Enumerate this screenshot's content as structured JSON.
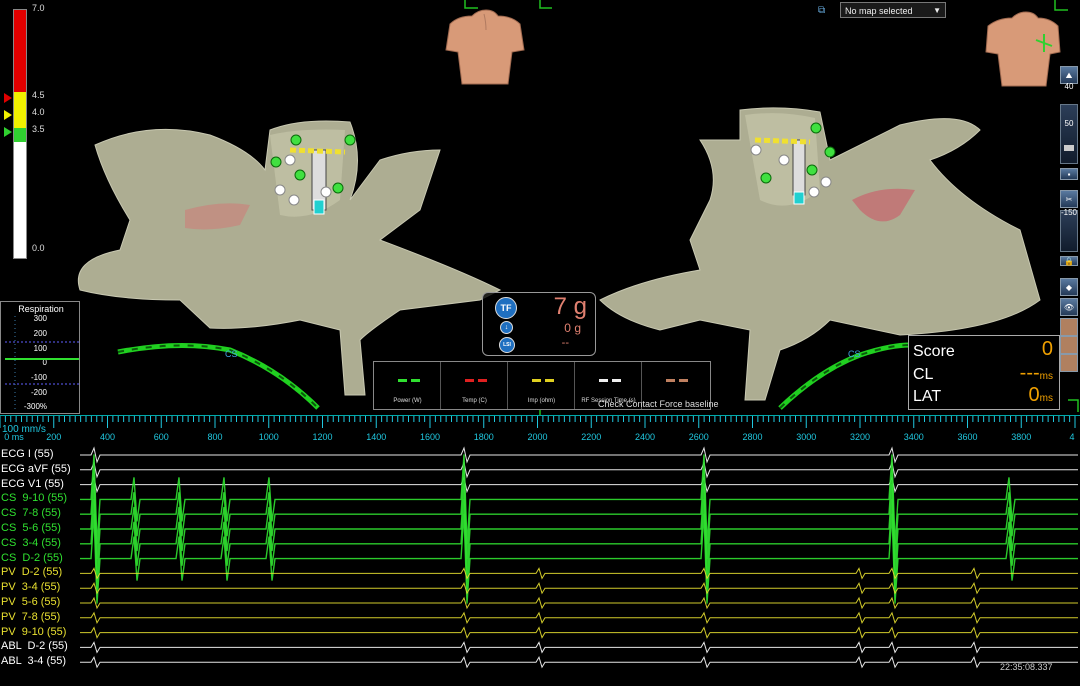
{
  "force_scale": {
    "max_label": "7.0",
    "labels": [
      "4.5",
      "4.0",
      "3.5"
    ],
    "min_label": "0.0",
    "colors": {
      "red": "#e00000",
      "yellow": "#f0f000",
      "green": "#30d030"
    }
  },
  "map_select": {
    "icon": "map-icon",
    "selected": "No map selected"
  },
  "toolbar": {
    "zoom_value": "40",
    "slider1_value": "50",
    "slider2_value": "-150"
  },
  "respiration": {
    "title": "Respiration",
    "labels": [
      "300",
      "200",
      "100",
      "0",
      "-100",
      "-200",
      "-300%"
    ]
  },
  "catheter_label": "CS",
  "score": {
    "score_label": "Score",
    "score_value": "0",
    "cl_label": "CL",
    "cl_value": "---",
    "cl_unit": "ms",
    "lat_label": "LAT",
    "lat_value": "0",
    "lat_unit": "ms"
  },
  "tf": {
    "badge": "TF",
    "lsi": "LSI",
    "force_value": "7",
    "force_unit": "g",
    "sub_value": "0",
    "sub_unit": "g",
    "lsi_value": "--"
  },
  "legend": [
    {
      "label": "Power (W)",
      "color": "#30e030"
    },
    {
      "label": "Temp (C)",
      "color": "#e02020"
    },
    {
      "label": "Imp (ohm)",
      "color": "#e0d020"
    },
    {
      "label": "RF Session Time (s)",
      "color": "#f0f0f0"
    },
    {
      "label": "",
      "color": "#c08060"
    }
  ],
  "status_message": "Check Contact Force baseline",
  "timeline": {
    "speed": "100 mm/s",
    "ticks": [
      "0 ms",
      "200",
      "400",
      "600",
      "800",
      "1000",
      "1200",
      "1400",
      "1600",
      "1800",
      "2000",
      "2200",
      "2400",
      "2600",
      "2800",
      "3000",
      "3200",
      "3400",
      "3600",
      "3800",
      "4"
    ]
  },
  "channels": [
    {
      "label": "ECG I (55)",
      "color": "#ffffff"
    },
    {
      "label": "ECG aVF (55)",
      "color": "#ffffff"
    },
    {
      "label": "ECG V1 (55)",
      "color": "#ffffff"
    },
    {
      "label": "CS  9-10 (55)",
      "color": "#30e030"
    },
    {
      "label": "CS  7-8 (55)",
      "color": "#30e030"
    },
    {
      "label": "CS  5-6 (55)",
      "color": "#30e030"
    },
    {
      "label": "CS  3-4 (55)",
      "color": "#30e030"
    },
    {
      "label": "CS  D-2 (55)",
      "color": "#30e030"
    },
    {
      "label": "PV  D-2 (55)",
      "color": "#e8e030"
    },
    {
      "label": "PV  3-4 (55)",
      "color": "#e8e030"
    },
    {
      "label": "PV  5-6 (55)",
      "color": "#e8e030"
    },
    {
      "label": "PV  7-8 (55)",
      "color": "#e8e030"
    },
    {
      "label": "PV  9-10 (55)",
      "color": "#e8e030"
    },
    {
      "label": "ABL  D-2 (55)",
      "color": "#ffffff"
    },
    {
      "label": "ABL  3-4 (55)",
      "color": "#ffffff"
    }
  ],
  "clock": "22:35:08.337"
}
